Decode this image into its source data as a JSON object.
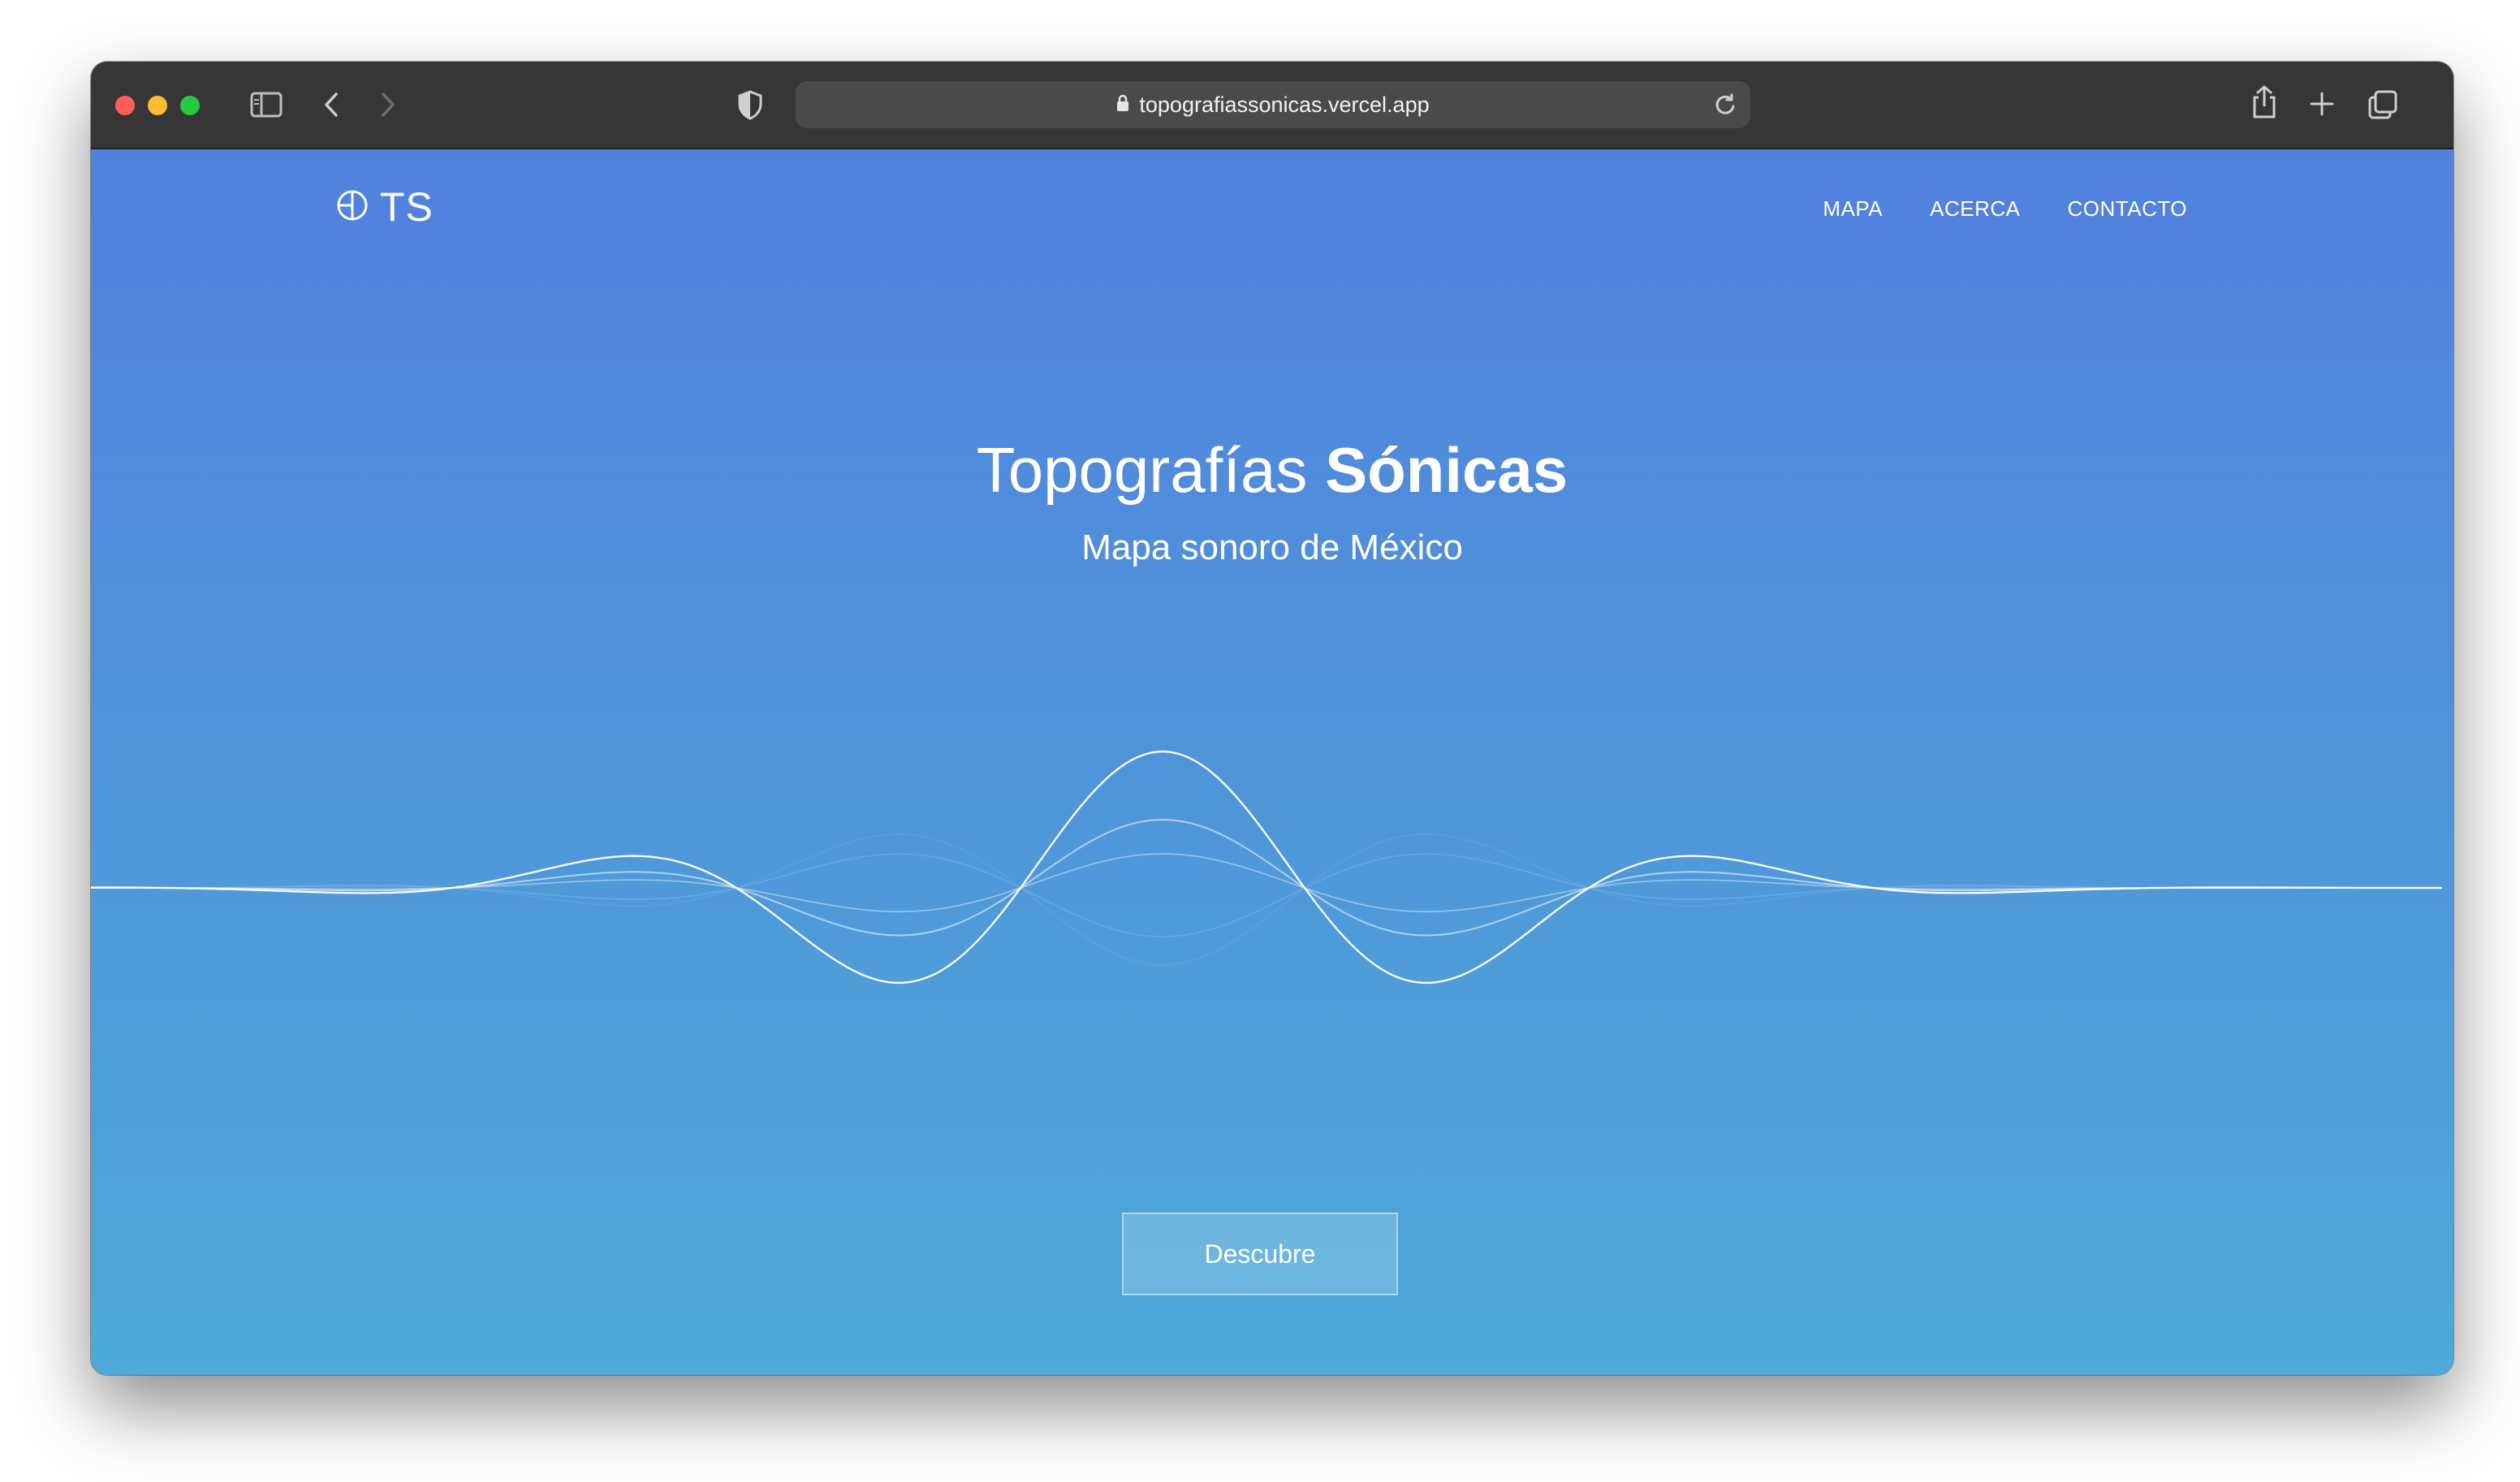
{
  "browser": {
    "url": "topografiassonicas.vercel.app",
    "traffic_lights": [
      "#ff5f57",
      "#febc2e",
      "#28c840"
    ],
    "icons": [
      "sidebar-icon",
      "back-icon",
      "forward-icon",
      "shield-icon",
      "lock-icon",
      "reload-icon",
      "share-icon",
      "new-tab-icon",
      "tabs-overview-icon"
    ]
  },
  "site": {
    "brand": "TS",
    "nav": [
      "MAPA",
      "ACERCA",
      "CONTACTO"
    ],
    "hero": {
      "title_light": "Topografías",
      "title_bold": "Sónicas",
      "subtitle": "Mapa sonoro de México"
    },
    "cta": "Descubre"
  },
  "colors": {
    "gradient_top": "#5181de",
    "gradient_bottom": "#4eaad8",
    "toolbar": "#363636",
    "text": "#ffffff"
  }
}
